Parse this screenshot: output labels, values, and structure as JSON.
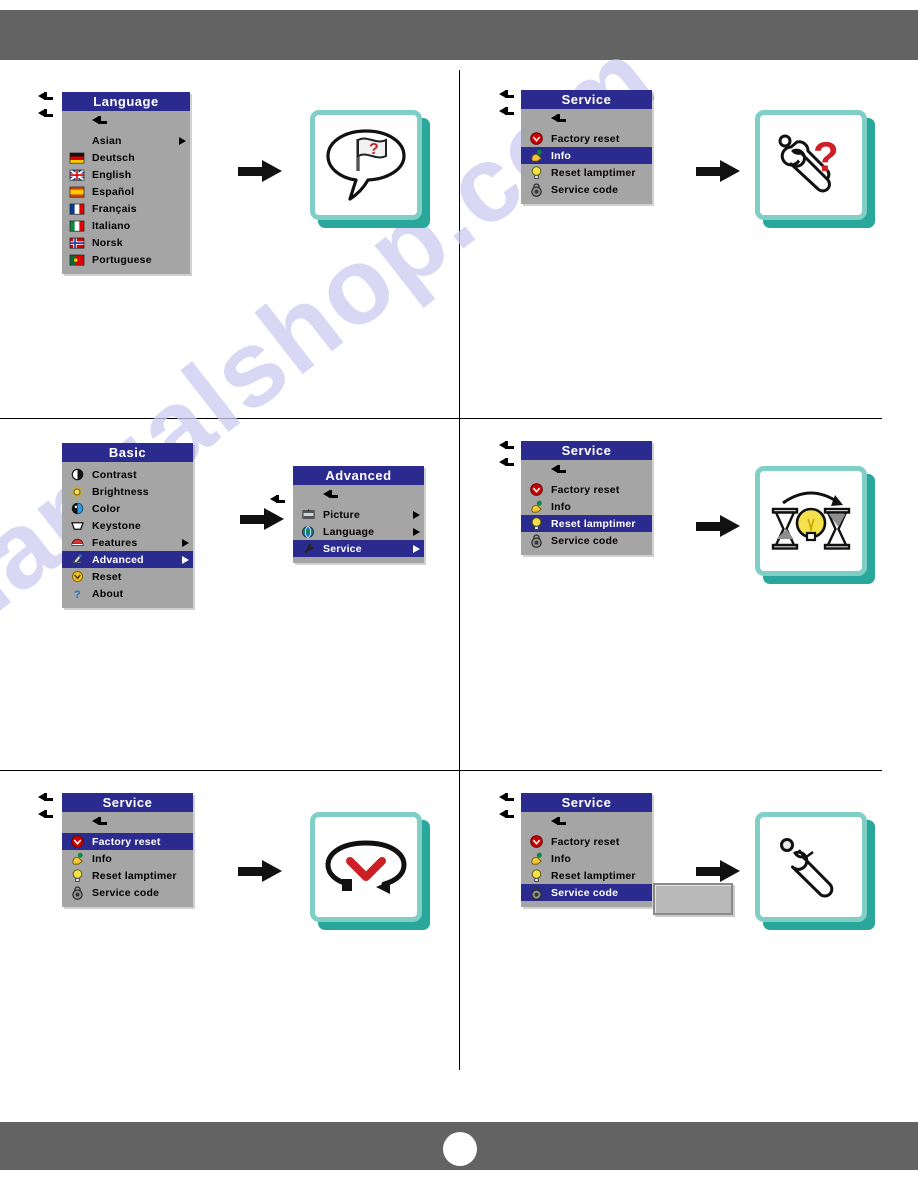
{
  "page": {
    "page_number": "",
    "watermark_text": "manualshop.com",
    "header_color": "#646363",
    "footer_color": "#646363"
  },
  "theme": {
    "menu_title_bg": "#2b2b8f",
    "menu_body_bg": "#a5a5a5",
    "menu_select_bg": "#2b2b8f",
    "card_border": "#7fcfc6",
    "card_shadow": "#2aa79b",
    "accent_red": "#cc2026",
    "accent_yellow": "#f5e14b"
  },
  "panels": {
    "language_menu": {
      "title": "Language",
      "back_label": "back",
      "items": [
        {
          "label": "Asian",
          "icon": "",
          "submenu": true,
          "selected": false
        },
        {
          "label": "Deutsch",
          "icon": "flag-de",
          "submenu": false,
          "selected": false
        },
        {
          "label": "English",
          "icon": "flag-uk",
          "submenu": false,
          "selected": false
        },
        {
          "label": "Español",
          "icon": "flag-es",
          "submenu": false,
          "selected": false
        },
        {
          "label": "Français",
          "icon": "flag-fr",
          "submenu": false,
          "selected": false
        },
        {
          "label": "Italiano",
          "icon": "flag-it",
          "submenu": false,
          "selected": false
        },
        {
          "label": "Norsk",
          "icon": "flag-no",
          "submenu": false,
          "selected": false
        },
        {
          "label": "Portuguese",
          "icon": "flag-pt",
          "submenu": false,
          "selected": false
        }
      ]
    },
    "service_menu_info": {
      "title": "Service",
      "items": [
        {
          "label": "Factory reset",
          "icon": "factory-reset-icon",
          "selected": false
        },
        {
          "label": "Info",
          "icon": "info-hand-icon",
          "selected": true
        },
        {
          "label": "Reset lamptimer",
          "icon": "lamp-icon",
          "selected": false
        },
        {
          "label": "Service code",
          "icon": "lock-icon",
          "selected": false
        }
      ]
    },
    "basic_menu": {
      "title": "Basic",
      "items": [
        {
          "label": "Contrast",
          "icon": "contrast-icon",
          "submenu": false,
          "selected": false
        },
        {
          "label": "Brightness",
          "icon": "brightness-icon",
          "submenu": false,
          "selected": false
        },
        {
          "label": "Color",
          "icon": "color-icon",
          "submenu": false,
          "selected": false
        },
        {
          "label": "Keystone",
          "icon": "keystone-icon",
          "submenu": false,
          "selected": false
        },
        {
          "label": "Features",
          "icon": "features-icon",
          "submenu": true,
          "selected": false
        },
        {
          "label": "Advanced",
          "icon": "advanced-icon",
          "submenu": true,
          "selected": true
        },
        {
          "label": "Reset",
          "icon": "reset-icon",
          "submenu": false,
          "selected": false
        },
        {
          "label": "About",
          "icon": "about-icon",
          "submenu": false,
          "selected": false
        }
      ]
    },
    "advanced_menu": {
      "title": "Advanced",
      "items": [
        {
          "label": "Picture",
          "icon": "picture-icon",
          "submenu": true,
          "selected": false
        },
        {
          "label": "Language",
          "icon": "globe-icon",
          "submenu": true,
          "selected": false
        },
        {
          "label": "Service",
          "icon": "wrench-icon",
          "submenu": true,
          "selected": true
        }
      ]
    },
    "service_menu_lamptimer": {
      "title": "Service",
      "items": [
        {
          "label": "Factory reset",
          "icon": "factory-reset-icon",
          "selected": false
        },
        {
          "label": "Info",
          "icon": "info-hand-icon",
          "selected": false
        },
        {
          "label": "Reset lamptimer",
          "icon": "lamp-icon",
          "selected": true
        },
        {
          "label": "Service code",
          "icon": "lock-icon",
          "selected": false
        }
      ]
    },
    "service_menu_factory": {
      "title": "Service",
      "items": [
        {
          "label": "Factory reset",
          "icon": "factory-reset-icon",
          "selected": true
        },
        {
          "label": "Info",
          "icon": "info-hand-icon",
          "selected": false
        },
        {
          "label": "Reset lamptimer",
          "icon": "lamp-icon",
          "selected": false
        },
        {
          "label": "Service code",
          "icon": "lock-icon",
          "selected": false
        }
      ]
    },
    "service_menu_code": {
      "title": "Service",
      "items": [
        {
          "label": "Factory reset",
          "icon": "factory-reset-icon",
          "selected": false
        },
        {
          "label": "Info",
          "icon": "info-hand-icon",
          "selected": false
        },
        {
          "label": "Reset lamptimer",
          "icon": "lamp-icon",
          "selected": false
        },
        {
          "label": "Service code",
          "icon": "lock-icon",
          "selected": true
        }
      ],
      "code_input_value": "",
      "code_input_placeholder": ""
    }
  },
  "cards": {
    "language_result": {
      "icon": "speech-bubble-flag-question-icon"
    },
    "info_result": {
      "icon": "wrench-question-icon"
    },
    "lamptimer_result": {
      "icon": "hourglass-lamp-hourglass-icon"
    },
    "factory_result": {
      "icon": "reset-loop-icon"
    },
    "code_result": {
      "icon": "wrench-icon"
    }
  }
}
